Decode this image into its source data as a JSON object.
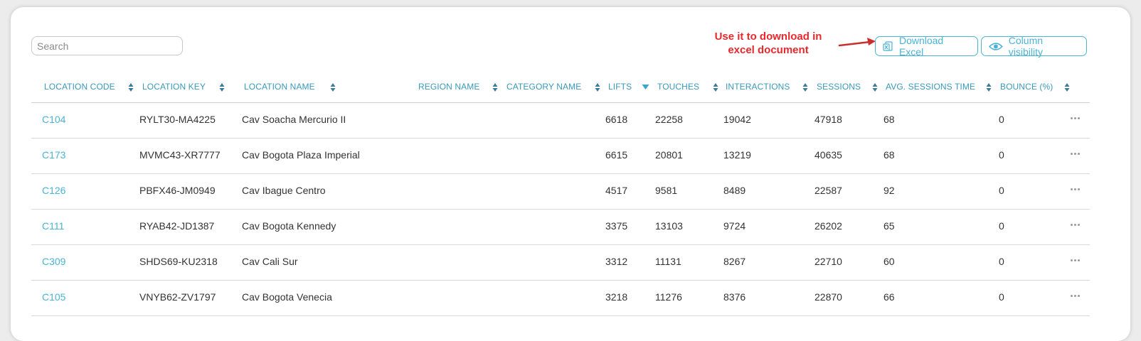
{
  "search": {
    "placeholder": "Search"
  },
  "annotation": {
    "text_line1": "Use it to download in",
    "text_line2": "excel document",
    "color": "#e8282d"
  },
  "toolbar": {
    "download_label": "Download Excel",
    "columns_label": "Column visibility"
  },
  "colors": {
    "accent": "#4ab3d4",
    "header": "#3a98b8"
  },
  "columns": [
    "LOCATION CODE",
    "LOCATION KEY",
    "LOCATION NAME",
    "REGION NAME",
    "CATEGORY NAME",
    "LIFTS",
    "TOUCHES",
    "INTERACTIONS",
    "SESSIONS",
    "AVG. SESSIONS TIME",
    "BOUNCE (%)"
  ],
  "sorted_column": "LIFTS",
  "rows": [
    {
      "code": "C104",
      "key": "RYLT30-MA4225",
      "name": "Cav Soacha Mercurio II",
      "region": "",
      "category": "",
      "lifts": "6618",
      "touches": "22258",
      "interactions": "19042",
      "sessions": "47918",
      "avg_time": "68",
      "bounce": "0"
    },
    {
      "code": "C173",
      "key": "MVMC43-XR7777",
      "name": "Cav Bogota Plaza Imperial",
      "region": "",
      "category": "",
      "lifts": "6615",
      "touches": "20801",
      "interactions": "13219",
      "sessions": "40635",
      "avg_time": "68",
      "bounce": "0"
    },
    {
      "code": "C126",
      "key": "PBFX46-JM0949",
      "name": "Cav Ibague Centro",
      "region": "",
      "category": "",
      "lifts": "4517",
      "touches": "9581",
      "interactions": "8489",
      "sessions": "22587",
      "avg_time": "92",
      "bounce": "0"
    },
    {
      "code": "C111",
      "key": "RYAB42-JD1387",
      "name": "Cav Bogota Kennedy",
      "region": "",
      "category": "",
      "lifts": "3375",
      "touches": "13103",
      "interactions": "9724",
      "sessions": "26202",
      "avg_time": "65",
      "bounce": "0"
    },
    {
      "code": "C309",
      "key": "SHDS69-KU2318",
      "name": "Cav Cali Sur",
      "region": "",
      "category": "",
      "lifts": "3312",
      "touches": "11131",
      "interactions": "8267",
      "sessions": "22710",
      "avg_time": "60",
      "bounce": "0"
    },
    {
      "code": "C105",
      "key": "VNYB62-ZV1797",
      "name": "Cav Bogota Venecia",
      "region": "",
      "category": "",
      "lifts": "3218",
      "touches": "11276",
      "interactions": "8376",
      "sessions": "22870",
      "avg_time": "66",
      "bounce": "0"
    }
  ]
}
